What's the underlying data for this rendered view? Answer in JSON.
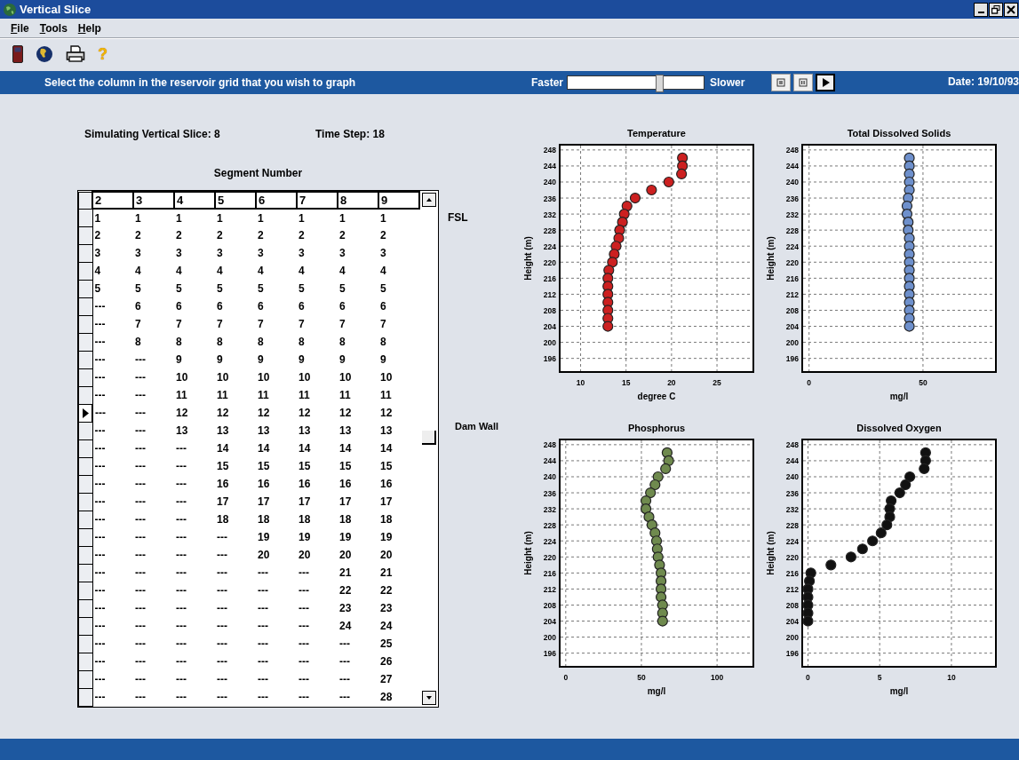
{
  "window": {
    "title": "Vertical Slice"
  },
  "menu": [
    "File",
    "Tools",
    "Help"
  ],
  "toolbar": [
    {
      "kind": "device"
    },
    {
      "kind": "globe"
    },
    {
      "kind": "printer"
    },
    {
      "kind": "help",
      "glyph": "?"
    }
  ],
  "banner": {
    "instruction": "Select the column in the reservoir grid that you wish to graph",
    "faster_label": "Faster",
    "slower_label": "Slower",
    "speed": {
      "level": 0.68
    },
    "playback": [
      {
        "kind": "stop",
        "selected": false
      },
      {
        "kind": "pause",
        "selected": false
      },
      {
        "kind": "play",
        "selected": true
      }
    ],
    "date": "Date: 19/10/93"
  },
  "simulation": {
    "slice_label": "Simulating Vertical Slice: 8",
    "time_step": "Time Step: 18"
  },
  "grid": {
    "title": "Segment Number",
    "columns": [
      "2",
      "3",
      "4",
      "5",
      "6",
      "7",
      "8",
      "9"
    ],
    "rows": [
      {
        "selected": false,
        "cells": [
          "1",
          "1",
          "1",
          "1",
          "1",
          "1",
          "1",
          "1"
        ]
      },
      {
        "selected": false,
        "cells": [
          "2",
          "2",
          "2",
          "2",
          "2",
          "2",
          "2",
          "2"
        ]
      },
      {
        "selected": false,
        "cells": [
          "3",
          "3",
          "3",
          "3",
          "3",
          "3",
          "3",
          "3"
        ]
      },
      {
        "selected": false,
        "cells": [
          "4",
          "4",
          "4",
          "4",
          "4",
          "4",
          "4",
          "4"
        ]
      },
      {
        "selected": false,
        "cells": [
          "5",
          "5",
          "5",
          "5",
          "5",
          "5",
          "5",
          "5"
        ]
      },
      {
        "selected": false,
        "cells": [
          "---",
          "6",
          "6",
          "6",
          "6",
          "6",
          "6",
          "6"
        ]
      },
      {
        "selected": false,
        "cells": [
          "---",
          "7",
          "7",
          "7",
          "7",
          "7",
          "7",
          "7"
        ]
      },
      {
        "selected": false,
        "cells": [
          "---",
          "8",
          "8",
          "8",
          "8",
          "8",
          "8",
          "8"
        ]
      },
      {
        "selected": false,
        "cells": [
          "---",
          "---",
          "9",
          "9",
          "9",
          "9",
          "9",
          "9"
        ]
      },
      {
        "selected": false,
        "cells": [
          "---",
          "---",
          "10",
          "10",
          "10",
          "10",
          "10",
          "10"
        ]
      },
      {
        "selected": false,
        "cells": [
          "---",
          "---",
          "11",
          "11",
          "11",
          "11",
          "11",
          "11"
        ]
      },
      {
        "selected": true,
        "cells": [
          "---",
          "---",
          "12",
          "12",
          "12",
          "12",
          "12",
          "12"
        ]
      },
      {
        "selected": false,
        "cells": [
          "---",
          "---",
          "13",
          "13",
          "13",
          "13",
          "13",
          "13"
        ]
      },
      {
        "selected": false,
        "cells": [
          "---",
          "---",
          "---",
          "14",
          "14",
          "14",
          "14",
          "14"
        ]
      },
      {
        "selected": false,
        "cells": [
          "---",
          "---",
          "---",
          "15",
          "15",
          "15",
          "15",
          "15"
        ]
      },
      {
        "selected": false,
        "cells": [
          "---",
          "---",
          "---",
          "16",
          "16",
          "16",
          "16",
          "16"
        ]
      },
      {
        "selected": false,
        "cells": [
          "---",
          "---",
          "---",
          "17",
          "17",
          "17",
          "17",
          "17"
        ]
      },
      {
        "selected": false,
        "cells": [
          "---",
          "---",
          "---",
          "18",
          "18",
          "18",
          "18",
          "18"
        ]
      },
      {
        "selected": false,
        "cells": [
          "---",
          "---",
          "---",
          "---",
          "19",
          "19",
          "19",
          "19"
        ]
      },
      {
        "selected": false,
        "cells": [
          "---",
          "---",
          "---",
          "---",
          "20",
          "20",
          "20",
          "20"
        ]
      },
      {
        "selected": false,
        "cells": [
          "---",
          "---",
          "---",
          "---",
          "---",
          "---",
          "21",
          "21"
        ]
      },
      {
        "selected": false,
        "cells": [
          "---",
          "---",
          "---",
          "---",
          "---",
          "---",
          "22",
          "22"
        ]
      },
      {
        "selected": false,
        "cells": [
          "---",
          "---",
          "---",
          "---",
          "---",
          "---",
          "23",
          "23"
        ]
      },
      {
        "selected": false,
        "cells": [
          "---",
          "---",
          "---",
          "---",
          "---",
          "---",
          "24",
          "24"
        ]
      },
      {
        "selected": false,
        "cells": [
          "---",
          "---",
          "---",
          "---",
          "---",
          "---",
          "---",
          "25"
        ]
      },
      {
        "selected": false,
        "cells": [
          "---",
          "---",
          "---",
          "---",
          "---",
          "---",
          "---",
          "26"
        ]
      },
      {
        "selected": false,
        "cells": [
          "---",
          "---",
          "---",
          "---",
          "---",
          "---",
          "---",
          "27"
        ]
      },
      {
        "selected": false,
        "cells": [
          "---",
          "---",
          "---",
          "---",
          "---",
          "---",
          "---",
          "28"
        ]
      }
    ],
    "side_labels": [
      "FSL",
      "Dam Wall"
    ]
  },
  "charts": [
    {
      "chart_data": {
        "type": "scatter",
        "title": "Temperature",
        "xlabel": "degree C",
        "ylabel": "Height (m)",
        "x": [
          21.2,
          21.2,
          21.1,
          19.7,
          17.8,
          16,
          15.1,
          14.8,
          14.6,
          14.3,
          14.2,
          13.9,
          13.7,
          13.5,
          13.1,
          13,
          13,
          13,
          13,
          13,
          13,
          13
        ],
        "series": [
          {
            "color": "#cc2020",
            "values": [
              246,
              244,
              242,
              240,
              238,
              236,
              234,
              232,
              230,
              228,
              226,
              224,
              222,
              220,
              218,
              216,
              214,
              212,
              210,
              208,
              206,
              204
            ]
          }
        ],
        "grid": true,
        "xlim": [
          7.7,
          29
        ],
        "ylim": [
          192.6,
          249.3
        ],
        "xticks": [
          10,
          15,
          20,
          25
        ],
        "yticks": [
          196,
          200,
          204,
          208,
          212,
          216,
          220,
          224,
          228,
          232,
          236,
          240,
          244,
          248
        ]
      }
    },
    {
      "chart_data": {
        "type": "scatter",
        "title": "Total Dissolved Solids",
        "xlabel": "mg/l",
        "ylabel": "Height (m)",
        "x": [
          44,
          44,
          44,
          44,
          44,
          43.5,
          43,
          43,
          43.5,
          43.5,
          44,
          44,
          44,
          44,
          44,
          44,
          44,
          44,
          44,
          44,
          44,
          44
        ],
        "series": [
          {
            "color": "#6e90cc",
            "values": [
              246,
              244,
              242,
              240,
              238,
              236,
              234,
              232,
              230,
              228,
              226,
              224,
              222,
              220,
              218,
              216,
              214,
              212,
              210,
              208,
              206,
              204
            ]
          }
        ],
        "grid": true,
        "xlim": [
          -3,
          82
        ],
        "ylim": [
          192.6,
          249.3
        ],
        "xticks": [
          0,
          50
        ],
        "yticks": [
          196,
          200,
          204,
          208,
          212,
          216,
          220,
          224,
          228,
          232,
          236,
          240,
          244,
          248
        ]
      }
    },
    {
      "chart_data": {
        "type": "scatter",
        "title": "Phosphorus",
        "xlabel": "mg/l",
        "ylabel": "Height (m)",
        "x": [
          67,
          68,
          66,
          61,
          59,
          56,
          53,
          53,
          55,
          57,
          59,
          60,
          60.5,
          61,
          62,
          63,
          63,
          63,
          63,
          64,
          64,
          64
        ],
        "series": [
          {
            "color": "#6f8a4e",
            "values": [
              246,
              244,
              242,
              240,
              238,
              236,
              234,
              232,
              230,
              228,
              226,
              224,
              222,
              220,
              218,
              216,
              214,
              212,
              210,
              208,
              206,
              204
            ]
          }
        ],
        "grid": true,
        "xlim": [
          -4,
          124
        ],
        "ylim": [
          192.6,
          249.3
        ],
        "xticks": [
          0,
          50,
          100
        ],
        "yticks": [
          196,
          200,
          204,
          208,
          212,
          216,
          220,
          224,
          228,
          232,
          236,
          240,
          244,
          248
        ]
      }
    },
    {
      "chart_data": {
        "type": "scatter",
        "title": "Dissolved Oxygen",
        "xlabel": "mg/l",
        "ylabel": "Height (m)",
        "x": [
          8.2,
          8.2,
          8.1,
          7.1,
          6.8,
          6.4,
          5.8,
          5.7,
          5.7,
          5.5,
          5.1,
          4.5,
          3.8,
          3,
          1.6,
          0.2,
          0.1,
          0,
          0,
          0,
          0,
          0
        ],
        "series": [
          {
            "color": "#111111",
            "values": [
              246,
              244,
              242,
              240,
              238,
              236,
              234,
              232,
              230,
              228,
              226,
              224,
              222,
              220,
              218,
              216,
              214,
              212,
              210,
              208,
              206,
              204
            ]
          }
        ],
        "grid": true,
        "xlim": [
          -0.4,
          13.1
        ],
        "ylim": [
          192.6,
          249.3
        ],
        "xticks": [
          0,
          5,
          10
        ],
        "yticks": [
          196,
          200,
          204,
          208,
          212,
          216,
          220,
          224,
          228,
          232,
          236,
          240,
          244,
          248
        ]
      }
    }
  ]
}
